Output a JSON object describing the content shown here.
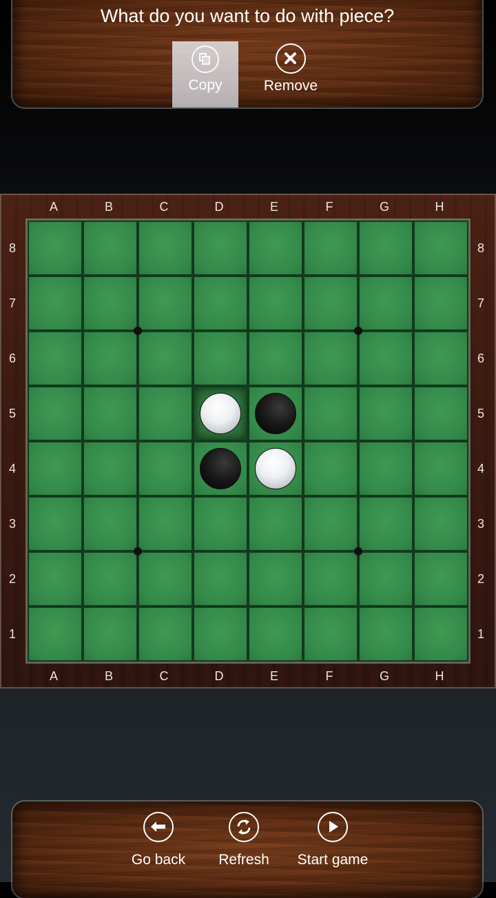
{
  "dialog": {
    "question": "What do you want to do with piece?",
    "actions": [
      {
        "label": "Copy",
        "icon": "copy-icon",
        "selected": true
      },
      {
        "label": "Remove",
        "icon": "close-circle-icon",
        "selected": false
      }
    ]
  },
  "board": {
    "columns": [
      "A",
      "B",
      "C",
      "D",
      "E",
      "F",
      "G",
      "H"
    ],
    "rows": [
      "8",
      "7",
      "6",
      "5",
      "4",
      "3",
      "2",
      "1"
    ],
    "pieces": [
      {
        "square": "D5",
        "color": "white",
        "selected": true
      },
      {
        "square": "E5",
        "color": "black",
        "selected": false
      },
      {
        "square": "D4",
        "color": "black",
        "selected": false
      },
      {
        "square": "E4",
        "color": "white",
        "selected": false
      }
    ],
    "star_points": [
      "C6/B7 corner",
      "F6/G7 corner",
      "C3/B2 corner",
      "F3/G2 corner"
    ],
    "colors": {
      "felt": "#34894a",
      "grid_line": "#123a1c",
      "frame": "#3b1b10"
    }
  },
  "toolbar": {
    "actions": [
      {
        "label": "Go back",
        "icon": "arrow-left-icon"
      },
      {
        "label": "Refresh",
        "icon": "refresh-icon"
      },
      {
        "label": "Start game",
        "icon": "play-icon"
      }
    ]
  }
}
